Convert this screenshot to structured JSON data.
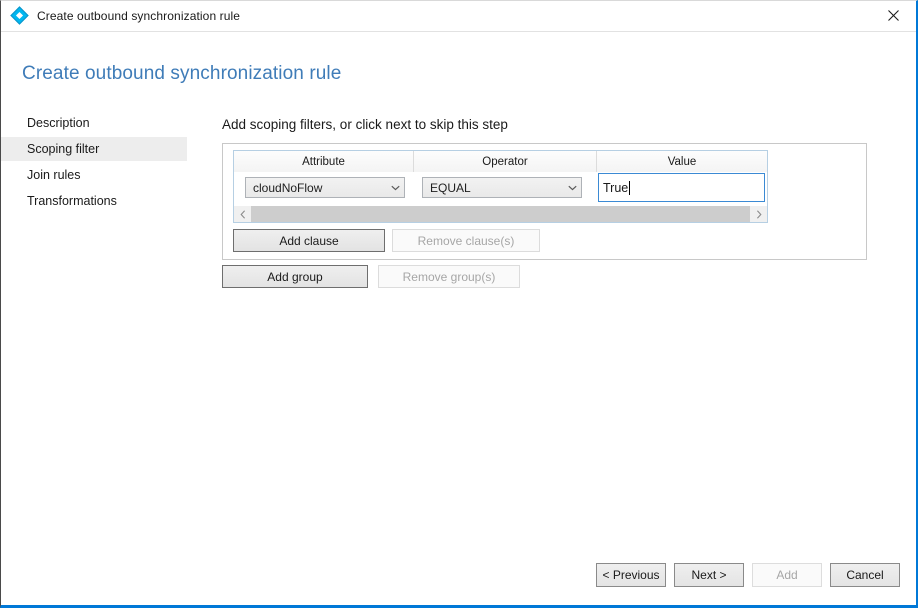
{
  "window": {
    "titlebar": {
      "icon": "sync-rule-diamond-icon",
      "title": "Create outbound synchronization rule",
      "close_label": "close-icon",
      "accent_color": "#0078d7",
      "icon_color": "#00b7f0"
    },
    "page_title": "Create outbound synchronization rule",
    "page_title_color": "#3f7cb8"
  },
  "nav": {
    "items": [
      {
        "label": "Description",
        "selected": false
      },
      {
        "label": "Scoping filter",
        "selected": true
      },
      {
        "label": "Join rules",
        "selected": false
      },
      {
        "label": "Transformations",
        "selected": false
      }
    ],
    "selected_background": "#ededed"
  },
  "main": {
    "heading": "Add scoping filters, or click next to skip this step",
    "clause_table": {
      "columns": [
        "Attribute",
        "Operator",
        "Value"
      ],
      "rows": [
        {
          "attribute": "cloudNoFlow",
          "operator": "EQUAL",
          "value": "True",
          "value_focused": true
        }
      ],
      "scrollbar": {
        "left_arrow": "chevron-left-icon",
        "right_arrow": "chevron-right-icon",
        "orientation": "horizontal"
      }
    },
    "clause_buttons": {
      "add": {
        "label": "Add clause",
        "enabled": true
      },
      "remove": {
        "label": "Remove clause(s)",
        "enabled": false
      }
    },
    "group_buttons": {
      "add": {
        "label": "Add group",
        "enabled": true
      },
      "remove": {
        "label": "Remove group(s)",
        "enabled": false
      }
    }
  },
  "footer": {
    "buttons": [
      {
        "label": "< Previous",
        "enabled": true
      },
      {
        "label": "Next >",
        "enabled": true
      },
      {
        "label": "Add",
        "enabled": false
      },
      {
        "label": "Cancel",
        "enabled": true
      }
    ]
  }
}
